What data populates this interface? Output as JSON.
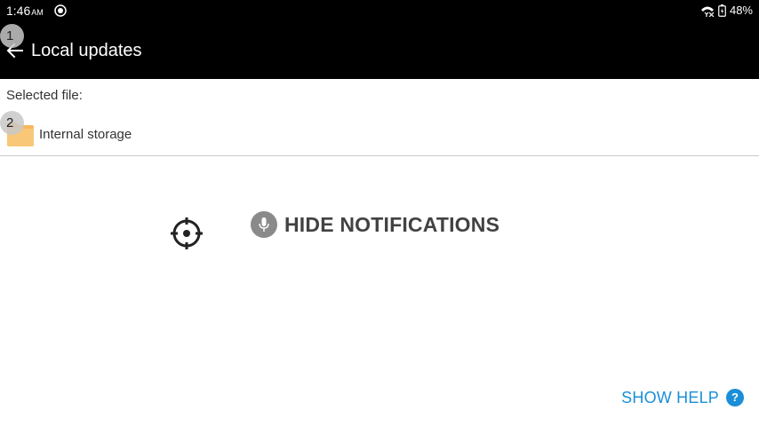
{
  "status_bar": {
    "time": "1:46",
    "ampm": "AM",
    "battery": "48%",
    "icons": [
      "sync-icon",
      "no-signal-icon",
      "battery-charging-icon"
    ]
  },
  "app_bar": {
    "title": "Local updates",
    "back_icon": "arrow-left-icon"
  },
  "badges": {
    "first": "1",
    "second": "2"
  },
  "file_section": {
    "selected_label": "Selected file:",
    "storage_label": "Internal storage",
    "folder_icon": "folder-icon",
    "folder_color": "#f6b960"
  },
  "overlay": {
    "crosshair_icon": "crosshair-icon",
    "hide_notifications_label": "HIDE NOTIFICATIONS",
    "mic_icon": "microphone-icon"
  },
  "help": {
    "show_help_label": "SHOW HELP",
    "help_icon_glyph": "?"
  },
  "colors": {
    "bar": "#000000",
    "accent": "#1a8fd8",
    "text": "#333333"
  }
}
